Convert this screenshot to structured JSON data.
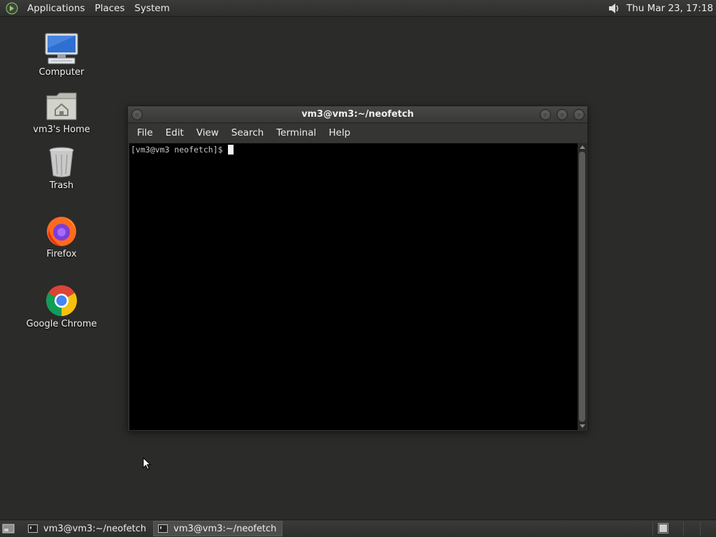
{
  "top_panel": {
    "menus": [
      "Applications",
      "Places",
      "System"
    ],
    "clock": "Thu Mar 23, 17:18",
    "volume_icon": "volume-icon"
  },
  "desktop": {
    "icons": [
      {
        "label": "Computer",
        "icon": "computer-icon"
      },
      {
        "label": "vm3's Home",
        "icon": "home-folder-icon"
      },
      {
        "label": "Trash",
        "icon": "trash-icon"
      },
      {
        "label": "Firefox",
        "icon": "firefox-icon"
      },
      {
        "label": "Google Chrome",
        "icon": "chrome-icon"
      }
    ]
  },
  "terminal": {
    "title": "vm3@vm3:~/neofetch",
    "menu": [
      "File",
      "Edit",
      "View",
      "Search",
      "Terminal",
      "Help"
    ],
    "prompt": "[vm3@vm3 neofetch]$"
  },
  "taskbar": {
    "tasks": [
      {
        "label": "vm3@vm3:~/neofetch",
        "active": false
      },
      {
        "label": "vm3@vm3:~/neofetch",
        "active": true
      }
    ]
  },
  "colors": {
    "desktop_bg": "#2b2b2a",
    "panel_bg": "#353534",
    "terminal_bg": "#000000"
  }
}
